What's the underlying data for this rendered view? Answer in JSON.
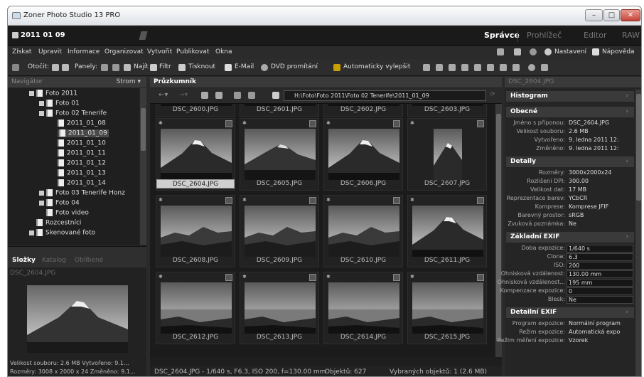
{
  "window": {
    "title": "Zoner Photo Studio 13 PRO"
  },
  "modebar": {
    "date": "2011 01 09",
    "tabs": [
      {
        "label": "Správce",
        "active": true
      },
      {
        "label": "Prohlížeč",
        "active": false
      },
      {
        "label": "Editor",
        "active": false
      },
      {
        "label": "RAW",
        "active": false
      }
    ]
  },
  "menu": [
    "Získat",
    "Upravit",
    "Informace",
    "Organizovat",
    "Vytvořit",
    "Publikovat",
    "Okna"
  ],
  "menu_right": {
    "settings": "Nastavení",
    "help": "Nápověda"
  },
  "toolbar": {
    "rotate": "Otočit:",
    "panels": "Panely:",
    "find": "Najít",
    "filter": "Filtr",
    "print": "Tisknout",
    "email": "E-Mail",
    "dvd": "DVD promítání",
    "enhance": "Automaticky vylepšit"
  },
  "navigator": {
    "title": "Navigátor",
    "mode": "Strom"
  },
  "tree": [
    {
      "label": "Foto 2011",
      "level": 0,
      "expander": true
    },
    {
      "label": "Foto 01",
      "level": 1,
      "expander": true
    },
    {
      "label": "Foto 02 Tenerife",
      "level": 1,
      "expander": true
    },
    {
      "label": "2011_01_08",
      "level": 2,
      "expander": false
    },
    {
      "label": "2011_01_09",
      "level": 2,
      "expander": false,
      "selected": true
    },
    {
      "label": "2011_01_10",
      "level": 2,
      "expander": false
    },
    {
      "label": "2011_01_11",
      "level": 2,
      "expander": false
    },
    {
      "label": "2011_01_12",
      "level": 2,
      "expander": false
    },
    {
      "label": "2011_01_13",
      "level": 2,
      "expander": false
    },
    {
      "label": "2011_01_14",
      "level": 2,
      "expander": false
    },
    {
      "label": "Foto 03 Tenerife Honz",
      "level": 1,
      "expander": true
    },
    {
      "label": "Foto 04",
      "level": 1,
      "expander": true
    },
    {
      "label": "Foto video",
      "level": 1,
      "expander": false
    },
    {
      "label": "Rozcestníci",
      "level": 0,
      "expander": false
    },
    {
      "label": "Skenované foto",
      "level": 0,
      "expander": true
    }
  ],
  "left_tabs": [
    {
      "label": "Složky",
      "active": true
    },
    {
      "label": "Katalog",
      "active": false
    },
    {
      "label": "Oblíbené",
      "active": false
    }
  ],
  "preview": {
    "title": "DSC_2604.JPG",
    "info1": "Velikost souboru: 2.6 MB   Vytvořeno: 9.1...",
    "info2": "Rozměry: 3008 x 2000 x 24   Změněno: 9.1..."
  },
  "explorer": {
    "title": "Průzkumník",
    "path": "H:\\Foto\\Foto 2011\\Foto 02 Tenerife\\2011_01_09"
  },
  "thumbs_top": [
    "DSC_2600.JPG",
    "DSC_2601.JPG",
    "DSC_2602.JPG",
    "DSC_2603.JPG"
  ],
  "thumbs": [
    {
      "name": "DSC_2604.JPG",
      "kind": "mountain",
      "selected": true
    },
    {
      "name": "DSC_2605.JPG",
      "kind": "mountain2"
    },
    {
      "name": "DSC_2606.JPG",
      "kind": "mountain"
    },
    {
      "name": "DSC_2607.JPG",
      "kind": "portrait"
    },
    {
      "name": "DSC_2608.JPG",
      "kind": "hills"
    },
    {
      "name": "DSC_2609.JPG",
      "kind": "hills"
    },
    {
      "name": "DSC_2610.JPG",
      "kind": "hills"
    },
    {
      "name": "DSC_2611.JPG",
      "kind": "mountain"
    },
    {
      "name": "DSC_2612.JPG",
      "kind": "coast"
    },
    {
      "name": "DSC_2613.JPG",
      "kind": "coast"
    },
    {
      "name": "DSC_2614.JPG",
      "kind": "coast"
    },
    {
      "name": "DSC_2615.JPG",
      "kind": "coast"
    }
  ],
  "status": {
    "file": "DSC_2604.JPG - 1/640 s, F6.3, ISO 200, f=130.00 mm",
    "objects": "Objektů: 627",
    "selected": "Vybraných objektů: 1 (2.6 MB)"
  },
  "info_panel": {
    "title": "DSC_2604.JPG",
    "sections": [
      {
        "label": "Histogram",
        "rows": []
      },
      {
        "label": "Obecné",
        "rows": [
          [
            "Jméno s příponou:",
            "DSC_2604.JPG"
          ],
          [
            "Velikost souboru:",
            "2.6 MB"
          ],
          [
            "Vytvořeno:",
            "9. ledna 2011 12:"
          ],
          [
            "Změněno:",
            "9. ledna 2011 12:"
          ]
        ]
      },
      {
        "label": "Detaily",
        "rows": [
          [
            "Rozměry:",
            "3000x2000x24"
          ],
          [
            "Rozlišení DPI:",
            "300.00"
          ],
          [
            "Velikost dat:",
            "17 MB"
          ],
          [
            "Reprezentace barev:",
            "YCbCR"
          ],
          [
            "Komprese:",
            "Komprese JFIF"
          ],
          [
            "Barevný prostor:",
            "sRGB"
          ],
          [
            "Zvuková poznámka:",
            "Ne"
          ]
        ]
      },
      {
        "label": "Základní EXIF",
        "boxed": true,
        "rows": [
          [
            "Doba expozice:",
            "1/640 s"
          ],
          [
            "Clona:",
            "6.3"
          ],
          [
            "ISO:",
            "200"
          ],
          [
            "Ohnisková vzdálenost:",
            "130.00 mm"
          ],
          [
            "Ohnisková vzdálenost...",
            "195 mm"
          ],
          [
            "Kompenzace expozice:",
            "0"
          ],
          [
            "Blesk:",
            "Ne"
          ]
        ]
      },
      {
        "label": "Detailní EXIF",
        "rows": [
          [
            "Program expozice:",
            "Normální program"
          ],
          [
            "Režim expozice:",
            "Automatická expo"
          ],
          [
            "Režim měření expozice:",
            "Vzorek"
          ]
        ]
      }
    ]
  }
}
